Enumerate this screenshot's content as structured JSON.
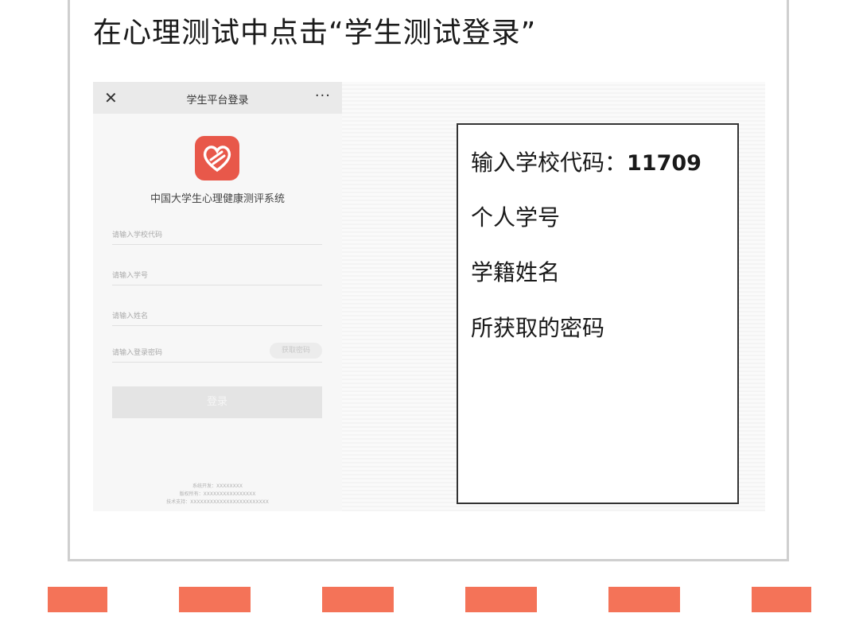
{
  "heading": "在心理测试中点击“学生测试登录”",
  "phone": {
    "close_glyph": "✕",
    "title": "学生平台登录",
    "more_glyph": "···",
    "system_name": "中国大学生心理健康测评系统",
    "fields": [
      {
        "placeholder": "请输入学校代码"
      },
      {
        "placeholder": "请输入学号"
      },
      {
        "placeholder": "请输入姓名"
      },
      {
        "placeholder": "请输入登录密码"
      }
    ],
    "sms_button": "获取密码",
    "login_button": "登录",
    "footer_lines": [
      "系统开发：XXXXXXXX",
      "版权所有：XXXXXXXXXXXXXXXX",
      "技术支持：XXXXXXXXXXXXXXXXXXXXXXXX"
    ]
  },
  "note": {
    "line1_label": "输入学校代码：",
    "line1_code": "11709",
    "line2": "个人学号",
    "line3": "学籍姓名",
    "line4": "所获取的密码"
  },
  "accent_color": "#f47358",
  "logo_color": "#e8584a",
  "icons": {
    "logo": "heart-icon",
    "close": "close-icon",
    "more": "more-icon"
  }
}
